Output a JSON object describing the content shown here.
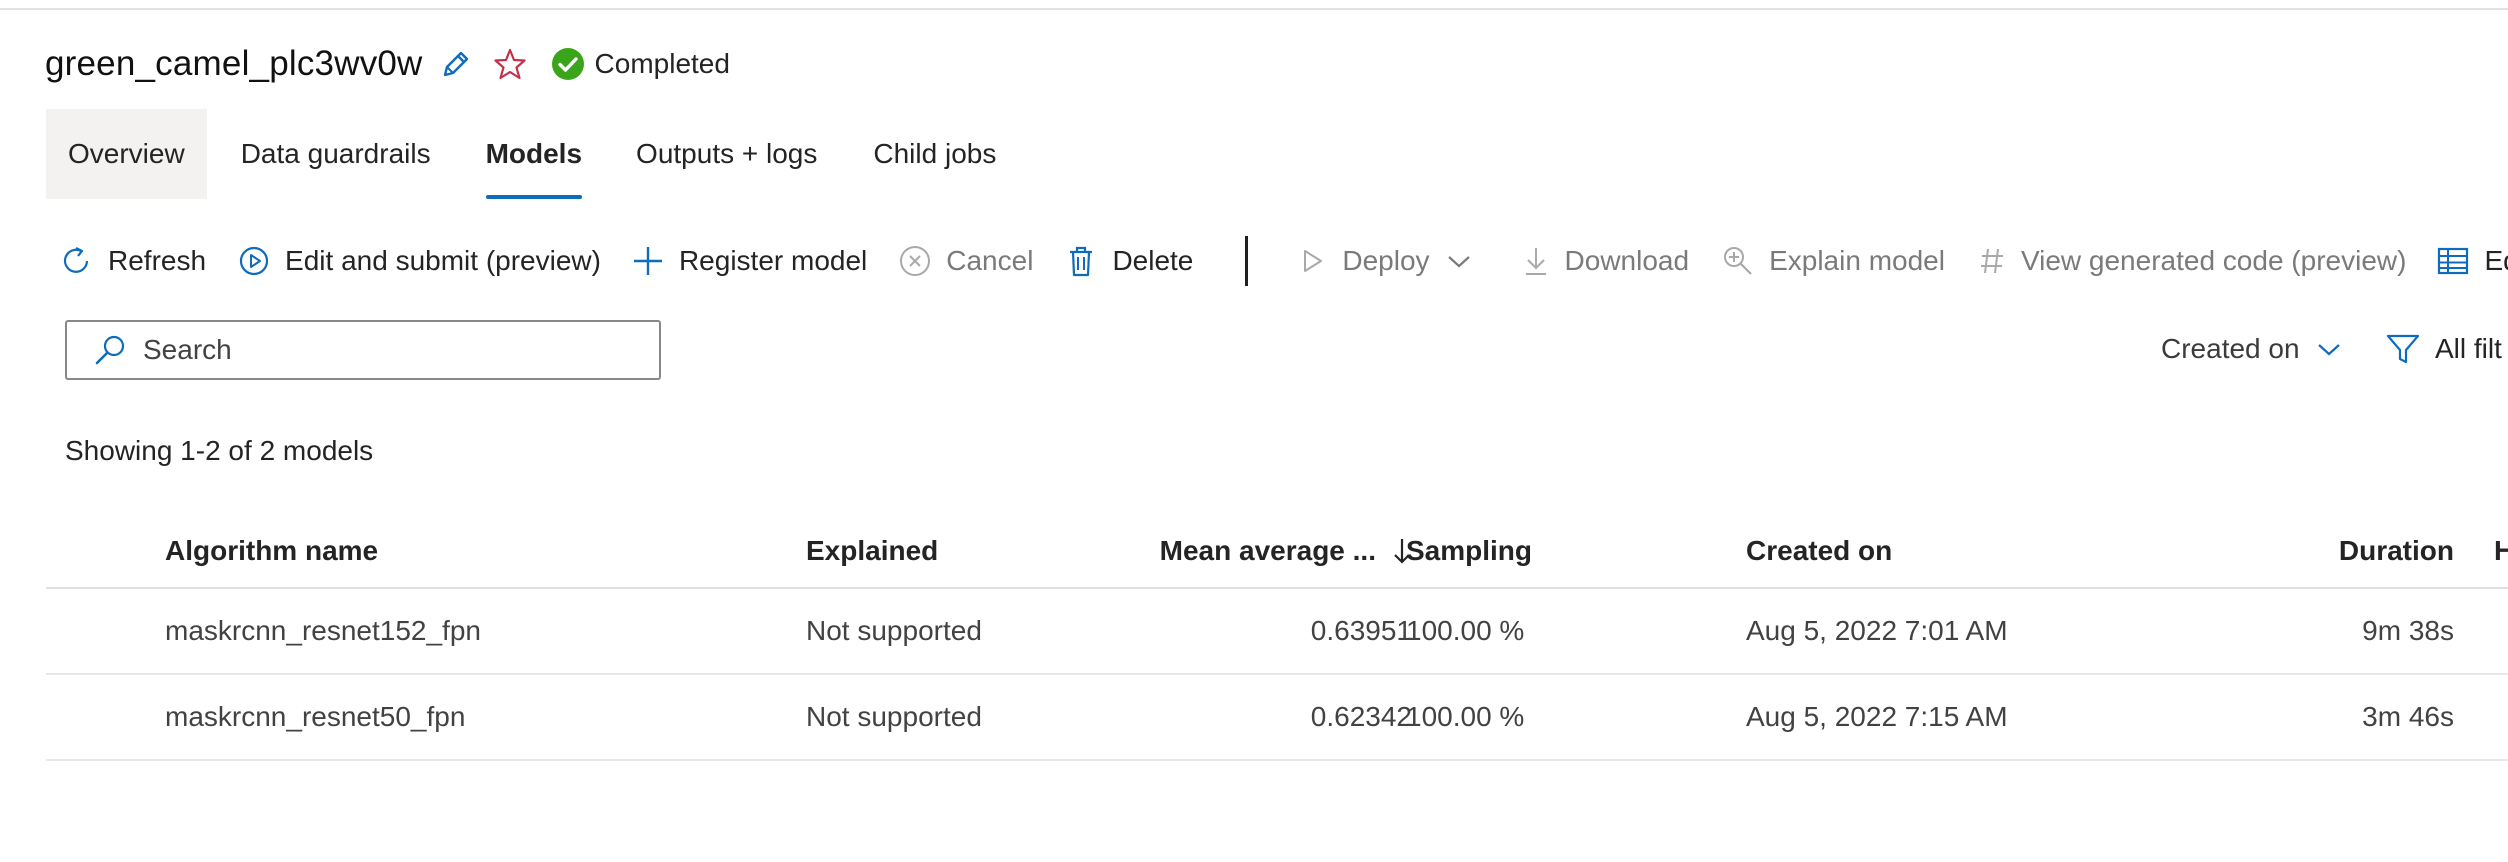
{
  "job": {
    "title": "green_camel_plc3wv0w",
    "status": "Completed",
    "status_color": "#3aa51b"
  },
  "tabs": [
    {
      "label": "Overview"
    },
    {
      "label": "Data guardrails"
    },
    {
      "label": "Models",
      "selected": true
    },
    {
      "label": "Outputs + logs"
    },
    {
      "label": "Child jobs"
    }
  ],
  "toolbar": {
    "refresh": "Refresh",
    "edit_submit": "Edit and submit (preview)",
    "register_model": "Register model",
    "cancel": "Cancel",
    "delete": "Delete",
    "deploy": "Deploy",
    "download": "Download",
    "explain_model": "Explain model",
    "view_code": "View generated code (preview)",
    "edit_columns": "Edi"
  },
  "search": {
    "placeholder": "Search",
    "value": ""
  },
  "sort": {
    "label": "Created on"
  },
  "filters": {
    "label": "All filt"
  },
  "summary": "Showing 1-2 of 2 models",
  "table": {
    "headers": {
      "algorithm": "Algorithm name",
      "explained": "Explained",
      "mean_average": "Mean average ...",
      "sampling": "Sampling",
      "created_on": "Created on",
      "duration": "Duration",
      "hidden_col": "H"
    },
    "rows": [
      {
        "algorithm": "maskrcnn_resnet152_fpn",
        "explained": "Not supported",
        "mean_average": "0.63951",
        "sampling": "100.00 %",
        "created_on": "Aug 5, 2022 7:01 AM",
        "duration": "9m 38s"
      },
      {
        "algorithm": "maskrcnn_resnet50_fpn",
        "explained": "Not supported",
        "mean_average": "0.62342",
        "sampling": "100.00 %",
        "created_on": "Aug 5, 2022 7:15 AM",
        "duration": "3m 46s"
      }
    ]
  },
  "colors": {
    "accent": "#0f6cbd",
    "star": "#c4314b",
    "disabled": "#7a7a7a"
  }
}
